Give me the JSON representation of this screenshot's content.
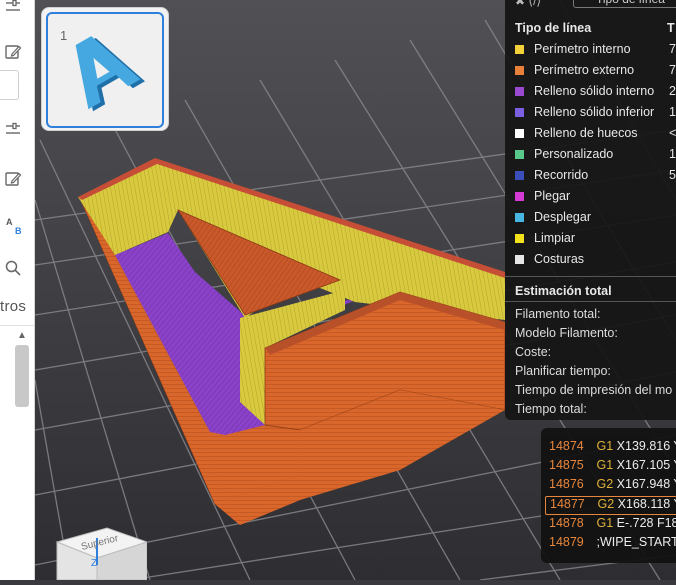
{
  "thumbnail": {
    "plate_number": "1"
  },
  "left_panel": {
    "filter_label": "tros",
    "translate_label_top": "A",
    "translate_label_bottom": "B"
  },
  "legend": {
    "top_icons_text": "✖ ⟨/⟩",
    "top_dropdown_value": "Tipo de línea",
    "header_left": "Tipo de línea",
    "header_right": "T",
    "rows": [
      {
        "label": "Perímetro interno",
        "value": "7",
        "color": "#f2d13a"
      },
      {
        "label": "Perímetro externo",
        "value": "7",
        "color": "#e8803a"
      },
      {
        "label": "Relleno sólido interno",
        "value": "2",
        "color": "#9a4ad0"
      },
      {
        "label": "Relleno sólido inferior",
        "value": "1",
        "color": "#7a60e0"
      },
      {
        "label": "Relleno de huecos",
        "value": "<",
        "color": "#ffffff"
      },
      {
        "label": "Personalizado",
        "value": "1",
        "color": "#58c98a"
      },
      {
        "label": "Recorrido",
        "value": "5",
        "color": "#3c4fb8"
      },
      {
        "label": "Plegar",
        "value": "",
        "color": "#d43ad4"
      },
      {
        "label": "Desplegar",
        "value": "",
        "color": "#47b6e0"
      },
      {
        "label": "Limpiar",
        "value": "",
        "color": "#f2e21c"
      },
      {
        "label": "Costuras",
        "value": "",
        "color": "#e6e6e6"
      }
    ],
    "estimate_title": "Estimación total",
    "estimate_rows": [
      "Filamento total:",
      "Modelo Filamento:",
      "Coste:",
      "Planificar tiempo:",
      "Tiempo de impresión del mo",
      "Tiempo total:"
    ]
  },
  "gcode": {
    "rows": [
      {
        "num": "14874",
        "cmd": "G1",
        "args": "X139.816 Y"
      },
      {
        "num": "14875",
        "cmd": "G1",
        "args": "X167.105 Y"
      },
      {
        "num": "14876",
        "cmd": "G2",
        "args": "X167.948 Y"
      },
      {
        "num": "14877",
        "cmd": "G2",
        "args": "X168.118 Y"
      },
      {
        "num": "14878",
        "cmd": "G1",
        "args": "E-.728 F18"
      },
      {
        "num": "14879",
        "cmd": "",
        "args": ";WIPE_START"
      }
    ],
    "active_index": 3
  },
  "navcube": {
    "face_label": "Superior",
    "axis_label": "Z"
  },
  "colors": {
    "outer_wall": "#d9662a",
    "inner_wall": "#d8c93e",
    "solid_infill": "#8a42c8",
    "top_surface": "#c9582a",
    "accent": "#2f7fdc"
  }
}
